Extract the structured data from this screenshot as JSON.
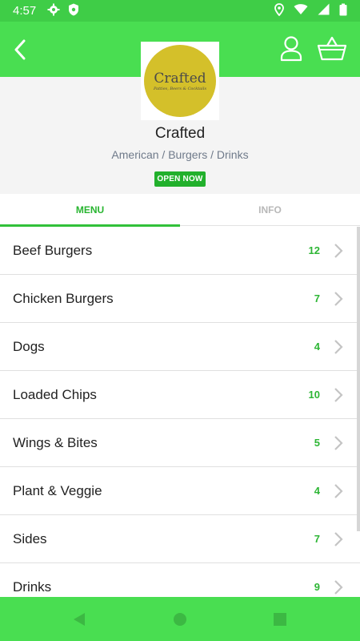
{
  "status_bar": {
    "time": "4:57",
    "left_icons": [
      "settings-icon",
      "shield-icon"
    ],
    "right_icons": [
      "location-icon",
      "wifi-icon",
      "signal-icon",
      "battery-icon"
    ]
  },
  "app_bar": {
    "icons": [
      "back-arrow-icon",
      "account-icon",
      "basket-icon"
    ]
  },
  "restaurant": {
    "logo_text": "Crafted",
    "logo_tagline": "Patties, Beers & Cocktails",
    "name": "Crafted",
    "cuisine": "American / Burgers / Drinks",
    "status": "OPEN NOW"
  },
  "tabs": [
    {
      "label": "MENU",
      "active": true
    },
    {
      "label": "INFO",
      "active": false
    }
  ],
  "menu": [
    {
      "label": "Beef Burgers",
      "count": "12"
    },
    {
      "label": "Chicken Burgers",
      "count": "7"
    },
    {
      "label": "Dogs",
      "count": "4"
    },
    {
      "label": "Loaded Chips",
      "count": "10"
    },
    {
      "label": "Wings & Bites",
      "count": "5"
    },
    {
      "label": "Plant & Veggie",
      "count": "4"
    },
    {
      "label": "Sides",
      "count": "7"
    },
    {
      "label": "Drinks",
      "count": "9"
    }
  ],
  "colors": {
    "app_bar": "#49de51",
    "status_bar": "#3fcd47",
    "accent": "#2db635",
    "logo": "#d4c02a"
  }
}
